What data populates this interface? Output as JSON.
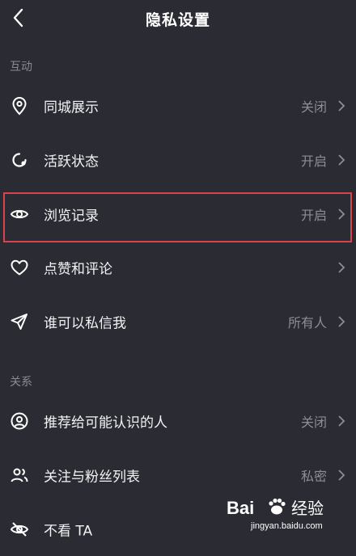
{
  "header": {
    "title": "隐私设置",
    "back_icon": "chevron-left-icon"
  },
  "sections": [
    {
      "title": "互动",
      "items": [
        {
          "label": "同城展示",
          "value": "关闭",
          "icon": "location-pin-icon"
        },
        {
          "label": "活跃状态",
          "value": "开启",
          "icon": "activity-status-icon"
        },
        {
          "label": "浏览记录",
          "value": "开启",
          "icon": "eye-icon",
          "highlighted": true
        },
        {
          "label": "点赞和评论",
          "value": "",
          "icon": "heart-icon"
        },
        {
          "label": "谁可以私信我",
          "value": "所有人",
          "icon": "send-icon"
        }
      ]
    },
    {
      "title": "关系",
      "items": [
        {
          "label": "推荐给可能认识的人",
          "value": "关闭",
          "icon": "user-circle-icon"
        },
        {
          "label": "关注与粉丝列表",
          "value": "私密",
          "icon": "users-icon"
        },
        {
          "label": "不看 TA",
          "value": "",
          "icon": "eye-off-icon"
        }
      ]
    }
  ],
  "watermark": {
    "brand": "Bai",
    "brand_suffix": "经验",
    "url": "jingyan.baidu.com"
  },
  "colors": {
    "background": "#2b2c33",
    "highlight": "#d8434d",
    "muted": "#8d8e95"
  }
}
